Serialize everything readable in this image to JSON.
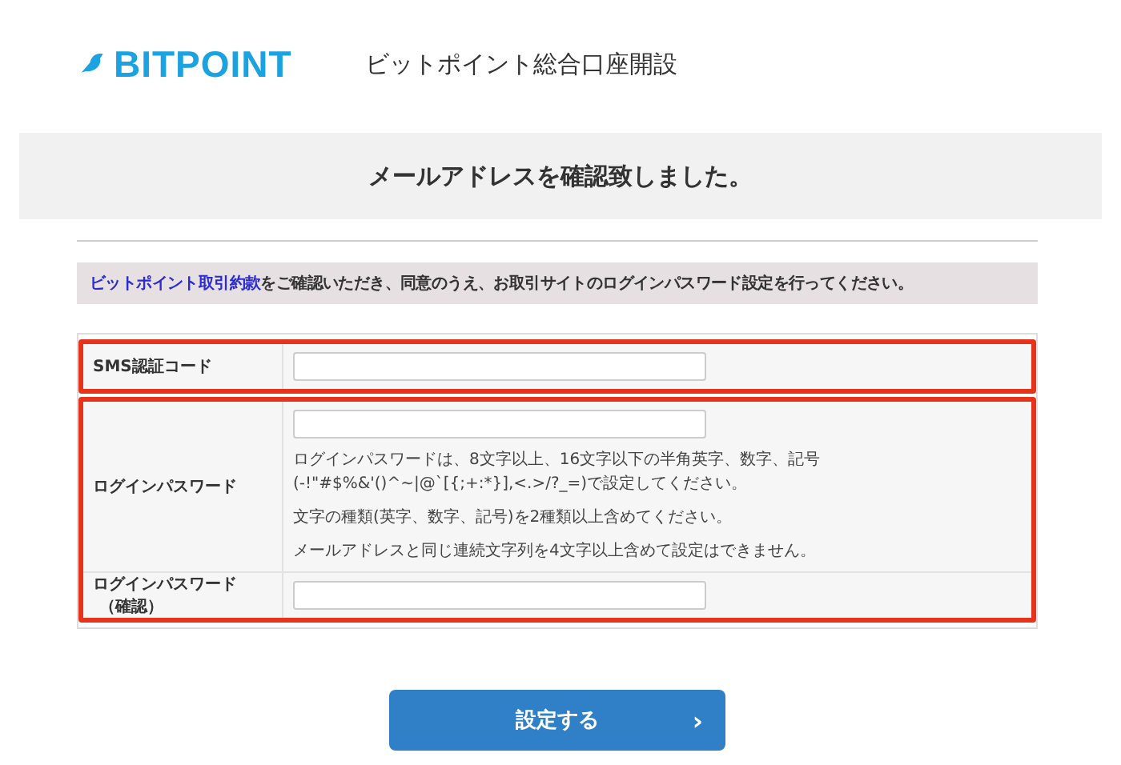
{
  "header": {
    "logo": "BITPOINT",
    "title": "ビットポイント総合口座開設"
  },
  "banner": {
    "title": "メールアドレスを確認致しました。"
  },
  "notice": {
    "link": "ビットポイント取引約款",
    "text": "をご確認いただき、同意のうえ、お取引サイトのログインパスワード設定を行ってください。"
  },
  "form_groups": [
    {
      "highlighted": true,
      "rows": [
        {
          "kind": "input",
          "label": [
            "SMS認証コード"
          ]
        }
      ]
    },
    {
      "highlighted": true,
      "rows": [
        {
          "kind": "input_notes",
          "label": [
            "ログインパスワード"
          ],
          "notes": [
            "ログインパスワードは、8文字以上、16文字以下の半角英字、数字、記号(-!\"#$%&'()^~|@`[{;+:*}],<.>/?_=)で設定してください。",
            "文字の種類(英字、数字、記号)を2種類以上含めてください。",
            "メールアドレスと同じ連続文字列を4文字以上含めて設定はできません。"
          ]
        },
        {
          "kind": "input",
          "label": [
            "ログインパスワード",
            "（確認）"
          ]
        }
      ]
    }
  ],
  "submit": {
    "label": "設定する",
    "arrow": "›"
  }
}
